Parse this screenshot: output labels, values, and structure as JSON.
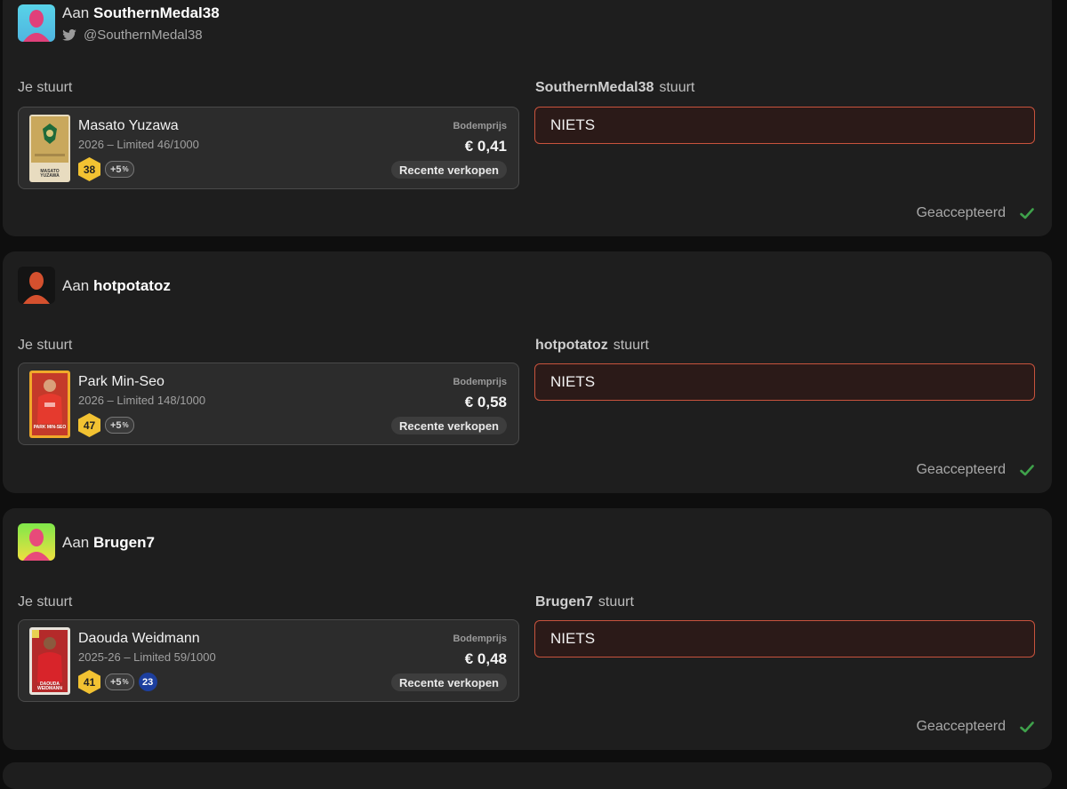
{
  "to_prefix": "Aan",
  "you_send_label": "Je stuurt",
  "sends_suffix": "stuurt",
  "floor_label": "Bodemprijs",
  "recent_sales_label": "Recente verkopen",
  "nothing_label": "NIETS",
  "status_label": "Geaccepteerd",
  "colors": {
    "accent_red": "#c8533d",
    "rating_gold": "#f2c232",
    "accepted_green": "#3fa14b"
  },
  "trades": [
    {
      "recipient": "SouthernMedal38",
      "twitter_handle": "@SouthernMedal38",
      "player": {
        "name": "Masato Yuzawa",
        "meta": "2026 – Limited 46/1000",
        "rating": "38",
        "bonus": "+5",
        "bonus_unit": "%",
        "price": "€ 0,41",
        "card_caption": "MASATO YUZAWA"
      }
    },
    {
      "recipient": "hotpotatoz",
      "player": {
        "name": "Park Min-Seo",
        "meta": "2026 – Limited 148/1000",
        "rating": "47",
        "bonus": "+5",
        "bonus_unit": "%",
        "price": "€ 0,58",
        "card_caption": "PARK MIN-SEO"
      }
    },
    {
      "recipient": "Brugen7",
      "player": {
        "name": "Daouda Weidmann",
        "meta": "2025-26 – Limited 59/1000",
        "rating": "41",
        "bonus": "+5",
        "bonus_unit": "%",
        "extra_badge": "23",
        "price": "€ 0,48",
        "card_caption": "DAOUDA WEIDMANN"
      }
    }
  ]
}
